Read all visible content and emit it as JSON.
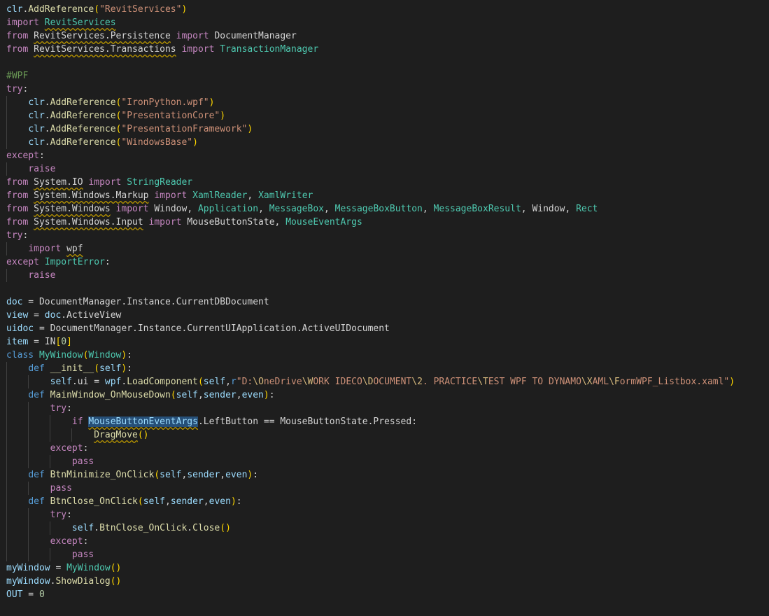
{
  "editor": {
    "lines": [
      {
        "indent": 0,
        "tokens": [
          {
            "t": "clr",
            "c": "v"
          },
          {
            "t": ".",
            "c": "d"
          },
          {
            "t": "AddReference",
            "c": "f"
          },
          {
            "t": "(",
            "c": "g"
          },
          {
            "t": "\"RevitServices\"",
            "c": "s"
          },
          {
            "t": ")",
            "c": "g"
          }
        ]
      },
      {
        "indent": 0,
        "tokens": [
          {
            "t": "import ",
            "c": "k"
          },
          {
            "t": "RevitServices",
            "c": "c",
            "u": true
          }
        ]
      },
      {
        "indent": 0,
        "tokens": [
          {
            "t": "from ",
            "c": "k"
          },
          {
            "t": "RevitServices.Persistence",
            "c": "d",
            "u": true
          },
          {
            "t": " import ",
            "c": "k"
          },
          {
            "t": "DocumentManager",
            "c": "d"
          }
        ]
      },
      {
        "indent": 0,
        "tokens": [
          {
            "t": "from ",
            "c": "k"
          },
          {
            "t": "RevitServices.Transactions",
            "c": "d",
            "u": true
          },
          {
            "t": " import ",
            "c": "k"
          },
          {
            "t": "TransactionManager",
            "c": "c"
          }
        ]
      },
      {
        "indent": 0,
        "tokens": []
      },
      {
        "indent": 0,
        "tokens": [
          {
            "t": "#WPF",
            "c": "m"
          }
        ]
      },
      {
        "indent": 0,
        "tokens": [
          {
            "t": "try",
            "c": "k"
          },
          {
            "t": ":",
            "c": "d"
          }
        ]
      },
      {
        "indent": 1,
        "tokens": [
          {
            "t": "clr",
            "c": "v"
          },
          {
            "t": ".",
            "c": "d"
          },
          {
            "t": "AddReference",
            "c": "f"
          },
          {
            "t": "(",
            "c": "g"
          },
          {
            "t": "\"IronPython.wpf\"",
            "c": "s"
          },
          {
            "t": ")",
            "c": "g"
          }
        ]
      },
      {
        "indent": 1,
        "tokens": [
          {
            "t": "clr",
            "c": "v"
          },
          {
            "t": ".",
            "c": "d"
          },
          {
            "t": "AddReference",
            "c": "f"
          },
          {
            "t": "(",
            "c": "g"
          },
          {
            "t": "\"PresentationCore\"",
            "c": "s"
          },
          {
            "t": ")",
            "c": "g"
          }
        ]
      },
      {
        "indent": 1,
        "tokens": [
          {
            "t": "clr",
            "c": "v"
          },
          {
            "t": ".",
            "c": "d"
          },
          {
            "t": "AddReference",
            "c": "f"
          },
          {
            "t": "(",
            "c": "g"
          },
          {
            "t": "\"PresentationFramework\"",
            "c": "s"
          },
          {
            "t": ")",
            "c": "g"
          }
        ]
      },
      {
        "indent": 1,
        "tokens": [
          {
            "t": "clr",
            "c": "v"
          },
          {
            "t": ".",
            "c": "d"
          },
          {
            "t": "AddReference",
            "c": "f"
          },
          {
            "t": "(",
            "c": "g"
          },
          {
            "t": "\"WindowsBase\"",
            "c": "s"
          },
          {
            "t": ")",
            "c": "g"
          }
        ]
      },
      {
        "indent": 0,
        "tokens": [
          {
            "t": "except",
            "c": "k"
          },
          {
            "t": ":",
            "c": "d"
          }
        ]
      },
      {
        "indent": 1,
        "tokens": [
          {
            "t": "raise",
            "c": "k"
          }
        ]
      },
      {
        "indent": 0,
        "tokens": [
          {
            "t": "from ",
            "c": "k"
          },
          {
            "t": "System.IO",
            "c": "d",
            "u": true
          },
          {
            "t": " import ",
            "c": "k"
          },
          {
            "t": "StringReader",
            "c": "c"
          }
        ]
      },
      {
        "indent": 0,
        "tokens": [
          {
            "t": "from ",
            "c": "k"
          },
          {
            "t": "System.Windows.Markup",
            "c": "d",
            "u": true
          },
          {
            "t": " import ",
            "c": "k"
          },
          {
            "t": "XamlReader",
            "c": "c"
          },
          {
            "t": ", ",
            "c": "d"
          },
          {
            "t": "XamlWriter",
            "c": "c"
          }
        ]
      },
      {
        "indent": 0,
        "tokens": [
          {
            "t": "from ",
            "c": "k"
          },
          {
            "t": "System.Windows",
            "c": "d",
            "u": true
          },
          {
            "t": " import ",
            "c": "k"
          },
          {
            "t": "Window",
            "c": "d"
          },
          {
            "t": ", ",
            "c": "d"
          },
          {
            "t": "Application",
            "c": "c"
          },
          {
            "t": ", ",
            "c": "d"
          },
          {
            "t": "MessageBox",
            "c": "c"
          },
          {
            "t": ", ",
            "c": "d"
          },
          {
            "t": "MessageBoxButton",
            "c": "c"
          },
          {
            "t": ", ",
            "c": "d"
          },
          {
            "t": "MessageBoxResult",
            "c": "c"
          },
          {
            "t": ", ",
            "c": "d"
          },
          {
            "t": "Window",
            "c": "d"
          },
          {
            "t": ", ",
            "c": "d"
          },
          {
            "t": "Rect",
            "c": "c"
          }
        ]
      },
      {
        "indent": 0,
        "tokens": [
          {
            "t": "from ",
            "c": "k"
          },
          {
            "t": "System.Windows.Input",
            "c": "d",
            "u": true
          },
          {
            "t": " import ",
            "c": "k"
          },
          {
            "t": "MouseButtonState",
            "c": "d"
          },
          {
            "t": ", ",
            "c": "d"
          },
          {
            "t": "MouseEventArgs",
            "c": "c"
          }
        ]
      },
      {
        "indent": 0,
        "tokens": [
          {
            "t": "try",
            "c": "k"
          },
          {
            "t": ":",
            "c": "d"
          }
        ]
      },
      {
        "indent": 1,
        "tokens": [
          {
            "t": "import ",
            "c": "k"
          },
          {
            "t": "wpf",
            "c": "d",
            "u": true
          }
        ]
      },
      {
        "indent": 0,
        "tokens": [
          {
            "t": "except ",
            "c": "k"
          },
          {
            "t": "ImportError",
            "c": "c"
          },
          {
            "t": ":",
            "c": "d"
          }
        ]
      },
      {
        "indent": 1,
        "tokens": [
          {
            "t": "raise",
            "c": "k"
          }
        ]
      },
      {
        "indent": 0,
        "tokens": []
      },
      {
        "indent": 0,
        "tokens": [
          {
            "t": "doc",
            "c": "v"
          },
          {
            "t": " = DocumentManager.Instance.CurrentDBDocument",
            "c": "d"
          }
        ]
      },
      {
        "indent": 0,
        "tokens": [
          {
            "t": "view",
            "c": "v"
          },
          {
            "t": " = ",
            "c": "d"
          },
          {
            "t": "doc",
            "c": "v"
          },
          {
            "t": ".ActiveView",
            "c": "d"
          }
        ]
      },
      {
        "indent": 0,
        "tokens": [
          {
            "t": "uidoc",
            "c": "v"
          },
          {
            "t": " = DocumentManager.Instance.CurrentUIApplication.ActiveUIDocument",
            "c": "d"
          }
        ]
      },
      {
        "indent": 0,
        "tokens": [
          {
            "t": "item",
            "c": "v"
          },
          {
            "t": " = IN",
            "c": "d"
          },
          {
            "t": "[",
            "c": "g"
          },
          {
            "t": "0",
            "c": "n"
          },
          {
            "t": "]",
            "c": "g"
          }
        ]
      },
      {
        "indent": 0,
        "tokens": [
          {
            "t": "class ",
            "c": "b"
          },
          {
            "t": "MyWindow",
            "c": "c"
          },
          {
            "t": "(",
            "c": "g"
          },
          {
            "t": "Window",
            "c": "c"
          },
          {
            "t": ")",
            "c": "g"
          },
          {
            "t": ":",
            "c": "d"
          }
        ]
      },
      {
        "indent": 1,
        "tokens": [
          {
            "t": "def ",
            "c": "b"
          },
          {
            "t": "__init__",
            "c": "f"
          },
          {
            "t": "(",
            "c": "g"
          },
          {
            "t": "self",
            "c": "v"
          },
          {
            "t": ")",
            "c": "g"
          },
          {
            "t": ":",
            "c": "d"
          }
        ]
      },
      {
        "indent": 2,
        "tokens": [
          {
            "t": "self",
            "c": "v"
          },
          {
            "t": ".ui = ",
            "c": "d"
          },
          {
            "t": "wpf",
            "c": "v"
          },
          {
            "t": ".",
            "c": "d"
          },
          {
            "t": "LoadComponent",
            "c": "f"
          },
          {
            "t": "(",
            "c": "g"
          },
          {
            "t": "self",
            "c": "v"
          },
          {
            "t": ",",
            "c": "d"
          },
          {
            "t": "r",
            "c": "b"
          },
          {
            "t": "\"D:",
            "c": "s"
          },
          {
            "t": "\\O",
            "c": "e"
          },
          {
            "t": "neDrive",
            "c": "s"
          },
          {
            "t": "\\W",
            "c": "e"
          },
          {
            "t": "ORK IDECO",
            "c": "s"
          },
          {
            "t": "\\D",
            "c": "e"
          },
          {
            "t": "OCUMENT",
            "c": "s"
          },
          {
            "t": "\\2",
            "c": "e"
          },
          {
            "t": ". PRACTICE",
            "c": "s"
          },
          {
            "t": "\\T",
            "c": "e"
          },
          {
            "t": "EST WPF TO DYNAMO",
            "c": "s"
          },
          {
            "t": "\\X",
            "c": "e"
          },
          {
            "t": "AML",
            "c": "s"
          },
          {
            "t": "\\F",
            "c": "e"
          },
          {
            "t": "ormWPF_Listbox.xaml\"",
            "c": "s"
          },
          {
            "t": ")",
            "c": "g"
          }
        ]
      },
      {
        "indent": 1,
        "tokens": [
          {
            "t": "def ",
            "c": "b"
          },
          {
            "t": "MainWindow_OnMouseDown",
            "c": "f"
          },
          {
            "t": "(",
            "c": "g"
          },
          {
            "t": "self",
            "c": "v"
          },
          {
            "t": ",",
            "c": "d"
          },
          {
            "t": "sender",
            "c": "v"
          },
          {
            "t": ",",
            "c": "d"
          },
          {
            "t": "even",
            "c": "v"
          },
          {
            "t": ")",
            "c": "g"
          },
          {
            "t": ":",
            "c": "d"
          }
        ]
      },
      {
        "indent": 2,
        "tokens": [
          {
            "t": "try",
            "c": "k"
          },
          {
            "t": ":",
            "c": "d"
          }
        ]
      },
      {
        "indent": 3,
        "tokens": [
          {
            "t": "if ",
            "c": "k"
          },
          {
            "t": "MouseButtonEventArgs",
            "c": "v",
            "u": true,
            "sel": true
          },
          {
            "t": ".LeftButton == MouseButtonState.Pressed:",
            "c": "d"
          }
        ]
      },
      {
        "indent": 4,
        "tokens": [
          {
            "t": "DragMove",
            "c": "f",
            "u": true
          },
          {
            "t": "()",
            "c": "g"
          }
        ]
      },
      {
        "indent": 2,
        "tokens": [
          {
            "t": "except",
            "c": "k"
          },
          {
            "t": ":",
            "c": "d"
          }
        ]
      },
      {
        "indent": 3,
        "tokens": [
          {
            "t": "pass",
            "c": "k"
          }
        ]
      },
      {
        "indent": 1,
        "tokens": [
          {
            "t": "def ",
            "c": "b"
          },
          {
            "t": "BtnMinimize_OnClick",
            "c": "f"
          },
          {
            "t": "(",
            "c": "g"
          },
          {
            "t": "self",
            "c": "v"
          },
          {
            "t": ",",
            "c": "d"
          },
          {
            "t": "sender",
            "c": "v"
          },
          {
            "t": ",",
            "c": "d"
          },
          {
            "t": "even",
            "c": "v"
          },
          {
            "t": ")",
            "c": "g"
          },
          {
            "t": ":",
            "c": "d"
          }
        ]
      },
      {
        "indent": 2,
        "tokens": [
          {
            "t": "pass",
            "c": "k"
          }
        ]
      },
      {
        "indent": 1,
        "tokens": [
          {
            "t": "def ",
            "c": "b"
          },
          {
            "t": "BtnClose_OnClick",
            "c": "f"
          },
          {
            "t": "(",
            "c": "g"
          },
          {
            "t": "self",
            "c": "v"
          },
          {
            "t": ",",
            "c": "d"
          },
          {
            "t": "sender",
            "c": "v"
          },
          {
            "t": ",",
            "c": "d"
          },
          {
            "t": "even",
            "c": "v"
          },
          {
            "t": ")",
            "c": "g"
          },
          {
            "t": ":",
            "c": "d"
          }
        ]
      },
      {
        "indent": 2,
        "tokens": [
          {
            "t": "try",
            "c": "k"
          },
          {
            "t": ":",
            "c": "d"
          }
        ]
      },
      {
        "indent": 3,
        "tokens": [
          {
            "t": "self",
            "c": "v"
          },
          {
            "t": ".",
            "c": "d"
          },
          {
            "t": "BtnClose_OnClick",
            "c": "f"
          },
          {
            "t": ".",
            "c": "d"
          },
          {
            "t": "Close",
            "c": "f"
          },
          {
            "t": "()",
            "c": "g"
          }
        ]
      },
      {
        "indent": 2,
        "tokens": [
          {
            "t": "except",
            "c": "k"
          },
          {
            "t": ":",
            "c": "d"
          }
        ]
      },
      {
        "indent": 3,
        "tokens": [
          {
            "t": "pass",
            "c": "k"
          }
        ]
      },
      {
        "indent": 0,
        "tokens": [
          {
            "t": "myWindow",
            "c": "v"
          },
          {
            "t": " = ",
            "c": "d"
          },
          {
            "t": "MyWindow",
            "c": "c"
          },
          {
            "t": "()",
            "c": "g"
          }
        ]
      },
      {
        "indent": 0,
        "tokens": [
          {
            "t": "myWindow",
            "c": "v"
          },
          {
            "t": ".",
            "c": "d"
          },
          {
            "t": "ShowDialog",
            "c": "f"
          },
          {
            "t": "()",
            "c": "g"
          }
        ]
      },
      {
        "indent": 0,
        "tokens": [
          {
            "t": "OUT",
            "c": "v"
          },
          {
            "t": " = ",
            "c": "d"
          },
          {
            "t": "0",
            "c": "n"
          }
        ]
      }
    ]
  }
}
